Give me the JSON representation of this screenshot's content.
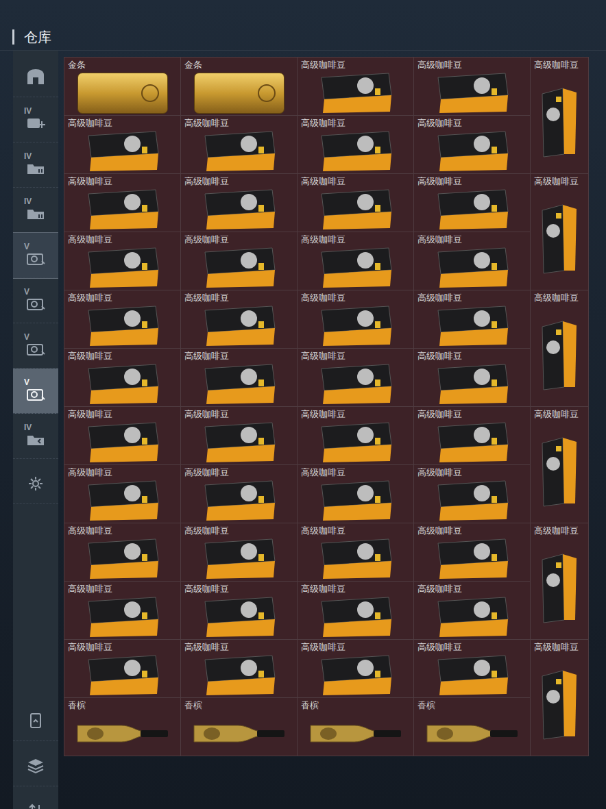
{
  "header": {
    "title": "仓库"
  },
  "sidebar": {
    "items": [
      {
        "kind": "home",
        "badge": "",
        "selected": false,
        "highlighted": false
      },
      {
        "kind": "add",
        "badge": "IV",
        "selected": false,
        "highlighted": false
      },
      {
        "kind": "folder",
        "badge": "IV",
        "selected": false,
        "highlighted": false
      },
      {
        "kind": "folder",
        "badge": "IV",
        "selected": false,
        "highlighted": false
      },
      {
        "kind": "camera",
        "badge": "V",
        "selected": false,
        "highlighted": true
      },
      {
        "kind": "camera",
        "badge": "V",
        "selected": false,
        "highlighted": false
      },
      {
        "kind": "camera",
        "badge": "V",
        "selected": false,
        "highlighted": false
      },
      {
        "kind": "camera",
        "badge": "V",
        "selected": true,
        "highlighted": false
      },
      {
        "kind": "folder-back",
        "badge": "IV",
        "selected": false,
        "highlighted": false
      },
      {
        "kind": "gear",
        "badge": "",
        "selected": false,
        "highlighted": false
      }
    ],
    "bottom": [
      {
        "kind": "trash",
        "badge": "",
        "selected": false,
        "highlighted": false
      },
      {
        "kind": "layers",
        "badge": "",
        "selected": false,
        "highlighted": false
      },
      {
        "kind": "sort",
        "badge": "",
        "selected": false,
        "highlighted": false
      }
    ]
  },
  "grid": {
    "items": [
      {
        "name": "金条",
        "kind": "gold-bar"
      },
      {
        "name": "金条",
        "kind": "gold-bar"
      },
      {
        "name": "高级咖啡豆",
        "kind": "coffee-flat"
      },
      {
        "name": "高级咖啡豆",
        "kind": "coffee-flat"
      },
      {
        "name": "高级咖啡豆",
        "kind": "coffee-tall"
      },
      {
        "name": "高级咖啡豆",
        "kind": "coffee-flat"
      },
      {
        "name": "高级咖啡豆",
        "kind": "coffee-flat"
      },
      {
        "name": "高级咖啡豆",
        "kind": "coffee-flat"
      },
      {
        "name": "高级咖啡豆",
        "kind": "coffee-flat"
      },
      {
        "name": "高级咖啡豆",
        "kind": "coffee-flat"
      },
      {
        "name": "高级咖啡豆",
        "kind": "coffee-flat"
      },
      {
        "name": "高级咖啡豆",
        "kind": "coffee-flat"
      },
      {
        "name": "高级咖啡豆",
        "kind": "coffee-flat"
      },
      {
        "name": "高级咖啡豆",
        "kind": "coffee-tall"
      },
      {
        "name": "高级咖啡豆",
        "kind": "coffee-flat"
      },
      {
        "name": "高级咖啡豆",
        "kind": "coffee-flat"
      },
      {
        "name": "高级咖啡豆",
        "kind": "coffee-flat"
      },
      {
        "name": "高级咖啡豆",
        "kind": "coffee-flat"
      },
      {
        "name": "高级咖啡豆",
        "kind": "coffee-flat"
      },
      {
        "name": "高级咖啡豆",
        "kind": "coffee-flat"
      },
      {
        "name": "高级咖啡豆",
        "kind": "coffee-flat"
      },
      {
        "name": "高级咖啡豆",
        "kind": "coffee-flat"
      },
      {
        "name": "高级咖啡豆",
        "kind": "coffee-tall"
      },
      {
        "name": "高级咖啡豆",
        "kind": "coffee-flat"
      },
      {
        "name": "高级咖啡豆",
        "kind": "coffee-flat"
      },
      {
        "name": "高级咖啡豆",
        "kind": "coffee-flat"
      },
      {
        "name": "高级咖啡豆",
        "kind": "coffee-flat"
      },
      {
        "name": "高级咖啡豆",
        "kind": "coffee-flat"
      },
      {
        "name": "高级咖啡豆",
        "kind": "coffee-flat"
      },
      {
        "name": "高级咖啡豆",
        "kind": "coffee-flat"
      },
      {
        "name": "高级咖啡豆",
        "kind": "coffee-flat"
      },
      {
        "name": "高级咖啡豆",
        "kind": "coffee-tall"
      },
      {
        "name": "高级咖啡豆",
        "kind": "coffee-flat"
      },
      {
        "name": "高级咖啡豆",
        "kind": "coffee-flat"
      },
      {
        "name": "高级咖啡豆",
        "kind": "coffee-flat"
      },
      {
        "name": "高级咖啡豆",
        "kind": "coffee-flat"
      },
      {
        "name": "高级咖啡豆",
        "kind": "coffee-flat"
      },
      {
        "name": "高级咖啡豆",
        "kind": "coffee-flat"
      },
      {
        "name": "高级咖啡豆",
        "kind": "coffee-flat"
      },
      {
        "name": "高级咖啡豆",
        "kind": "coffee-flat"
      },
      {
        "name": "高级咖啡豆",
        "kind": "coffee-tall"
      },
      {
        "name": "高级咖啡豆",
        "kind": "coffee-flat"
      },
      {
        "name": "高级咖啡豆",
        "kind": "coffee-flat"
      },
      {
        "name": "高级咖啡豆",
        "kind": "coffee-flat"
      },
      {
        "name": "高级咖啡豆",
        "kind": "coffee-flat"
      },
      {
        "name": "高级咖啡豆",
        "kind": "coffee-flat"
      },
      {
        "name": "高级咖啡豆",
        "kind": "coffee-flat"
      },
      {
        "name": "高级咖啡豆",
        "kind": "coffee-flat"
      },
      {
        "name": "高级咖啡豆",
        "kind": "coffee-flat"
      },
      {
        "name": "高级咖啡豆",
        "kind": "coffee-tall"
      },
      {
        "name": "香槟",
        "kind": "champagne"
      },
      {
        "name": "香槟",
        "kind": "champagne"
      },
      {
        "name": "香槟",
        "kind": "champagne"
      },
      {
        "name": "香槟",
        "kind": "champagne"
      }
    ]
  }
}
